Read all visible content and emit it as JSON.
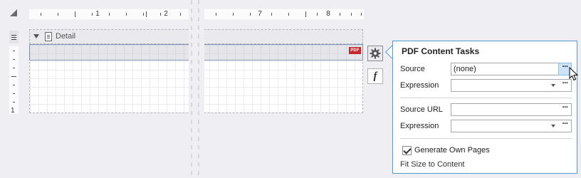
{
  "ruler": {
    "h_labels": [
      "1",
      "2",
      "7",
      "8"
    ],
    "v_label": "1"
  },
  "band": {
    "label": "Detail"
  },
  "control": {
    "badge": "PDF"
  },
  "smart_tags": {
    "expression_glyph": "f"
  },
  "panel": {
    "title": "PDF Content Tasks",
    "source": {
      "label": "Source",
      "value": "(none)",
      "button": "···"
    },
    "source_expression": {
      "label": "Expression",
      "value": "",
      "button": "···"
    },
    "source_url": {
      "label": "Source URL",
      "value": "",
      "button": "···"
    },
    "url_expression": {
      "label": "Expression",
      "value": "",
      "button": "···"
    },
    "generate_own_pages": {
      "label": "Generate Own Pages",
      "checked": true
    },
    "fit_size_link": "Fit Size to Content"
  },
  "colors": {
    "accent": "#4a9bd6",
    "pdf_badge": "#c4282d",
    "hover": "#cbe2f7"
  }
}
